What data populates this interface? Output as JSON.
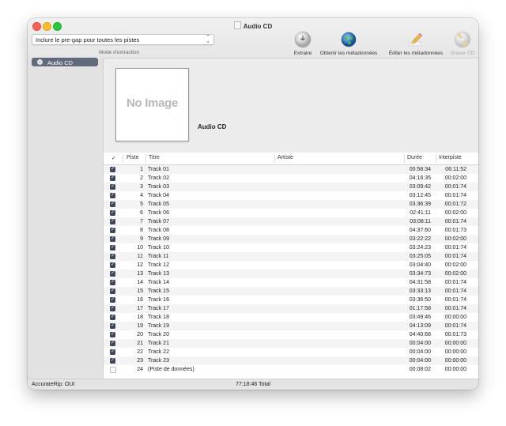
{
  "window": {
    "title": "Audio CD"
  },
  "toolbar": {
    "mode_select_value": "Inclure le pre-gap pour toutes les pistes",
    "mode_caption": "Mode d'extraction",
    "buttons": [
      {
        "label": "Extraire",
        "icon": "disc-extract-icon",
        "enabled": true
      },
      {
        "label": "Obtenir les métadonnées",
        "icon": "globe-icon",
        "enabled": true
      },
      {
        "label": "Éditer les métadonnées",
        "icon": "pencil-icon",
        "enabled": true
      },
      {
        "label": "Graver CD",
        "icon": "burn-disc-icon",
        "enabled": false
      }
    ]
  },
  "sidebar": {
    "items": [
      {
        "label": "Audio CD",
        "icon": "cd-icon",
        "selected": true
      }
    ]
  },
  "album": {
    "cover_placeholder": "No Image",
    "title": "Audio CD"
  },
  "table": {
    "headers": {
      "check": "✓",
      "track": "Piste",
      "title": "Titre",
      "artist": "Artiste",
      "duration": "Durée",
      "pregap": "Interpiste"
    },
    "rows": [
      {
        "checked": true,
        "num": "1",
        "title": "Track 01",
        "artist": "",
        "duration": "00:58:34",
        "pregap": "06:11:52"
      },
      {
        "checked": true,
        "num": "2",
        "title": "Track 02",
        "artist": "",
        "duration": "04:16:35",
        "pregap": "00:02:00"
      },
      {
        "checked": true,
        "num": "3",
        "title": "Track 03",
        "artist": "",
        "duration": "03:09:42",
        "pregap": "00:01:74"
      },
      {
        "checked": true,
        "num": "4",
        "title": "Track 04",
        "artist": "",
        "duration": "03:12:45",
        "pregap": "00:01:74"
      },
      {
        "checked": true,
        "num": "5",
        "title": "Track 05",
        "artist": "",
        "duration": "03:36:39",
        "pregap": "00:01:72"
      },
      {
        "checked": true,
        "num": "6",
        "title": "Track 06",
        "artist": "",
        "duration": "02:41:11",
        "pregap": "00:02:00"
      },
      {
        "checked": true,
        "num": "7",
        "title": "Track 07",
        "artist": "",
        "duration": "03:08:11",
        "pregap": "00:01:74"
      },
      {
        "checked": true,
        "num": "8",
        "title": "Track 08",
        "artist": "",
        "duration": "04:37:60",
        "pregap": "00:01:73"
      },
      {
        "checked": true,
        "num": "9",
        "title": "Track 09",
        "artist": "",
        "duration": "03:22:22",
        "pregap": "00:02:00"
      },
      {
        "checked": true,
        "num": "10",
        "title": "Track 10",
        "artist": "",
        "duration": "03:24:23",
        "pregap": "00:01:74"
      },
      {
        "checked": true,
        "num": "11",
        "title": "Track 11",
        "artist": "",
        "duration": "03:25:05",
        "pregap": "00:01:74"
      },
      {
        "checked": true,
        "num": "12",
        "title": "Track 12",
        "artist": "",
        "duration": "03:04:40",
        "pregap": "00:02:00"
      },
      {
        "checked": true,
        "num": "13",
        "title": "Track 13",
        "artist": "",
        "duration": "03:34:73",
        "pregap": "00:02:00"
      },
      {
        "checked": true,
        "num": "14",
        "title": "Track 14",
        "artist": "",
        "duration": "04:31:58",
        "pregap": "00:01:74"
      },
      {
        "checked": true,
        "num": "15",
        "title": "Track 15",
        "artist": "",
        "duration": "03:33:13",
        "pregap": "00:01:74"
      },
      {
        "checked": true,
        "num": "16",
        "title": "Track 16",
        "artist": "",
        "duration": "03:36:50",
        "pregap": "00:01:74"
      },
      {
        "checked": true,
        "num": "17",
        "title": "Track 17",
        "artist": "",
        "duration": "01:17:58",
        "pregap": "00:01:74"
      },
      {
        "checked": true,
        "num": "18",
        "title": "Track 18",
        "artist": "",
        "duration": "03:49:46",
        "pregap": "00:00:00"
      },
      {
        "checked": true,
        "num": "19",
        "title": "Track 19",
        "artist": "",
        "duration": "04:13:09",
        "pregap": "00:01:74"
      },
      {
        "checked": true,
        "num": "20",
        "title": "Track 20",
        "artist": "",
        "duration": "04:40:68",
        "pregap": "00:01:73"
      },
      {
        "checked": true,
        "num": "21",
        "title": "Track 21",
        "artist": "",
        "duration": "00:04:00",
        "pregap": "00:00:00"
      },
      {
        "checked": true,
        "num": "22",
        "title": "Track 22",
        "artist": "",
        "duration": "00:04:00",
        "pregap": "00:00:00"
      },
      {
        "checked": true,
        "num": "23",
        "title": "Track 23",
        "artist": "",
        "duration": "00:04:00",
        "pregap": "00:00:00"
      },
      {
        "checked": false,
        "num": "24",
        "title": "(Piste de données)",
        "artist": "",
        "duration": "00:08:02",
        "pregap": "00:00:00"
      }
    ]
  },
  "status": {
    "accuraterip": "AccurateRip: OUI",
    "total": "77:18:46 Total"
  },
  "colors": {
    "selection": "#616b7c",
    "checkbox": "#3c4657"
  }
}
